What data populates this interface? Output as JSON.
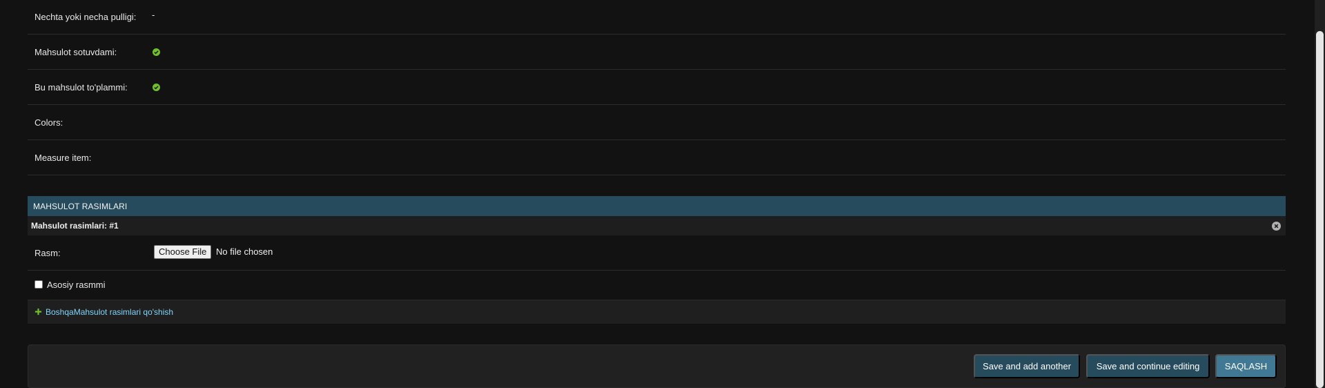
{
  "fields": [
    {
      "label": "Nechta yoki necha pulligi:",
      "value": "-",
      "kind": "text"
    },
    {
      "label": "Mahsulot sotuvdami:",
      "value": "",
      "kind": "boolean-true"
    },
    {
      "label": "Bu mahsulot to'plammi:",
      "value": "",
      "kind": "boolean-true"
    },
    {
      "label": "Colors:",
      "value": "",
      "kind": "text"
    },
    {
      "label": "Measure item:",
      "value": "",
      "kind": "text"
    }
  ],
  "inline": {
    "module_title": "MAHSULOT RASIMLARI",
    "item_title": "Mahsulot rasimlari: #1",
    "rasm_label": "Rasm:",
    "file_button": "Choose File",
    "file_status": "No file chosen",
    "checkbox_label": "Asosiy rasmmi",
    "checkbox_checked": false,
    "add_link": "BoshqaMahsulot rasimlari qo'shish"
  },
  "buttons": {
    "save_add_another": "Save and add another",
    "save_continue": "Save and continue editing",
    "save": "SAQLASH"
  },
  "colors": {
    "background": "#121212",
    "module_header": "#264b5d",
    "primary_button": "#417893",
    "success_icon": "#70bf2b",
    "link": "#81d4fa"
  }
}
